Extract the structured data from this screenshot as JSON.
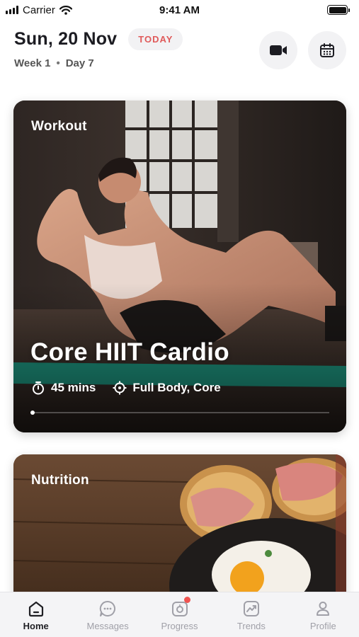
{
  "status_bar": {
    "carrier": "Carrier",
    "time": "9:41 AM"
  },
  "header": {
    "date": "Sun, 20 Nov",
    "badge": "TODAY",
    "week": "Week 1",
    "separator": "•",
    "day": "Day 7"
  },
  "workout_card": {
    "label": "Workout",
    "title": "Core HIIT Cardio",
    "duration": "45 mins",
    "focus": "Full Body, Core",
    "progress": 0
  },
  "nutrition_card": {
    "label": "Nutrition"
  },
  "tabs": [
    {
      "label": "Home",
      "icon": "home-icon",
      "active": true
    },
    {
      "label": "Messages",
      "icon": "chat-icon"
    },
    {
      "label": "Progress",
      "icon": "camera-icon",
      "badge": true
    },
    {
      "label": "Trends",
      "icon": "trend-icon"
    },
    {
      "label": "Profile",
      "icon": "user-icon"
    }
  ],
  "colors": {
    "accent": "#e05a5a",
    "badge_dot": "#ef5350",
    "tab_inactive": "#a0a0a8"
  }
}
